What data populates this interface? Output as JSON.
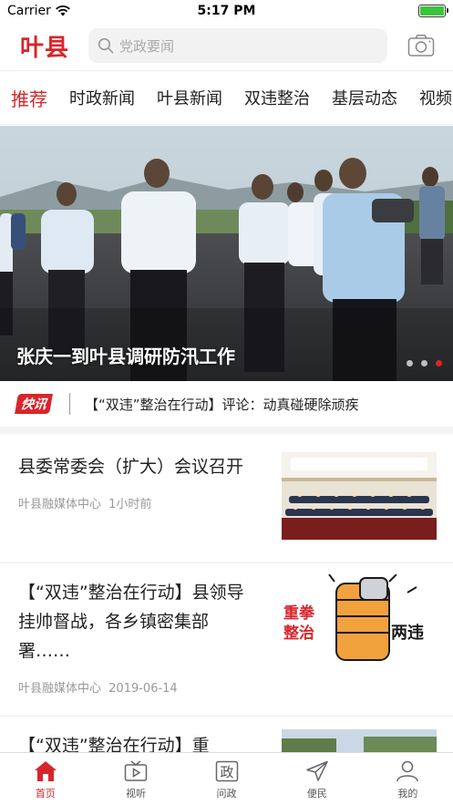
{
  "status_bar": {
    "carrier": "Carrier",
    "time": "5:17 PM"
  },
  "header": {
    "logo_text": "叶县",
    "search_placeholder": "党政要闻"
  },
  "tabs": [
    {
      "label": "推荐",
      "active": true
    },
    {
      "label": "时政新闻"
    },
    {
      "label": "叶县新闻"
    },
    {
      "label": "双违整治"
    },
    {
      "label": "基层动态"
    },
    {
      "label": "视频"
    }
  ],
  "banner": {
    "caption": "张庆一到叶县调研防汛工作",
    "slide_count": 3,
    "active_slide": 3
  },
  "flash": {
    "badge": "快讯",
    "text": "【“双违”整治在行动】评论：动真碰硬除顽疾"
  },
  "news": [
    {
      "title": "县委常委会（扩大）会议召开",
      "source": "叶县融媒体中心",
      "time": "1小时前"
    },
    {
      "title": "【“双违”整治在行动】县领导挂帅督战，各乡镇密集部署……",
      "source": "叶县融媒体中心",
      "time": "2019-06-14",
      "thumb_text": [
        "重拳",
        "整治",
        "两违"
      ]
    },
    {
      "title": "【“双违”整治在行动】重"
    }
  ],
  "tabbar": [
    {
      "label": "首页",
      "icon": "home-icon",
      "active": true
    },
    {
      "label": "视听",
      "icon": "tv-icon"
    },
    {
      "label": "问政",
      "icon": "zheng-icon",
      "glyph": "政"
    },
    {
      "label": "便民",
      "icon": "send-icon"
    },
    {
      "label": "我的",
      "icon": "user-icon"
    }
  ],
  "colors": {
    "accent": "#d8252b",
    "battery": "#3cc33c"
  }
}
